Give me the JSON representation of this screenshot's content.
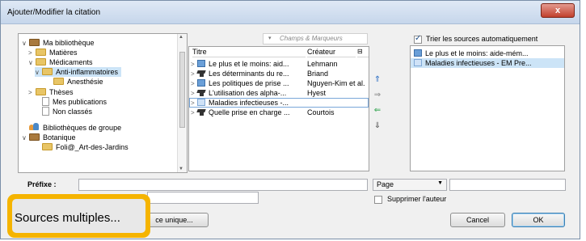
{
  "window": {
    "title": "Ajouter/Modifier la citation",
    "close_glyph": "x"
  },
  "library_tree": [
    {
      "label": "Ma bibliothèque",
      "arrow": "∨",
      "icon": "folder-brown"
    },
    {
      "label": "Matières",
      "arrow": ">",
      "icon": "folder"
    },
    {
      "label": "Médicaments",
      "arrow": "∨",
      "icon": "folder"
    },
    {
      "label": "Anti-inflammatoires",
      "arrow": "∨",
      "icon": "folder",
      "selected": true
    },
    {
      "label": "Anesthésie",
      "arrow": "",
      "icon": "folder"
    },
    {
      "label": "Thèses",
      "arrow": ">",
      "icon": "folder"
    },
    {
      "label": "Mes publications",
      "arrow": "",
      "icon": "doc"
    },
    {
      "label": "Non classés",
      "arrow": "",
      "icon": "doc"
    },
    {
      "label": "Bibliothèques de groupe",
      "arrow": "",
      "icon": "group"
    },
    {
      "label": "Botanique",
      "arrow": "∨",
      "icon": "folder-brown"
    },
    {
      "label": "Foli@_Art-des-Jardins",
      "arrow": "",
      "icon": "folder"
    }
  ],
  "search": {
    "placeholder": "Champs & Marqueurs",
    "icon": "chevron-down-icon"
  },
  "items_table": {
    "headers": {
      "title": "Titre",
      "creator": "Créateur",
      "options_glyph": "⊟"
    },
    "rows": [
      {
        "title": "Le plus et le moins: aid...",
        "creator": "Lehmann",
        "icon": "book"
      },
      {
        "title": "Les déterminants du re...",
        "creator": "Briand",
        "icon": "cap"
      },
      {
        "title": "Les politiques de prise ...",
        "creator": "Nguyen-Kim et al.",
        "icon": "book"
      },
      {
        "title": "L'utilisation des alpha-...",
        "creator": "Hyest",
        "icon": "cap"
      },
      {
        "title": "Maladies infectieuses -...",
        "creator": "",
        "icon": "book-light",
        "selected": true
      },
      {
        "title": "Quelle prise en charge ...",
        "creator": "Courtois",
        "icon": "cap"
      }
    ]
  },
  "move_buttons": {
    "up": "⇑",
    "add": "⇒",
    "remove": "⇐",
    "down": "⇓"
  },
  "sort_checkbox": {
    "label": "Trier les sources automatiquement",
    "checked": true
  },
  "selected_sources": [
    {
      "label": "Le plus et le moins: aide-mém...",
      "icon": "book"
    },
    {
      "label": "Maladies infectieuses - EM Pre...",
      "icon": "book-light",
      "selected": true
    }
  ],
  "citation_fields": {
    "prefix_label": "Préfixe :",
    "prefix_value": "",
    "locator_value": "Page",
    "locator_text": "",
    "suffix_value": ""
  },
  "suppress_author": {
    "label": "Supprimer l'auteur",
    "checked": false
  },
  "buttons": {
    "multiple_sources": "Sources multiples...",
    "single_source": "ce unique...",
    "cancel": "Cancel",
    "ok": "OK"
  },
  "colors": {
    "highlight": "#f5b400",
    "selection": "#cce4f7"
  }
}
